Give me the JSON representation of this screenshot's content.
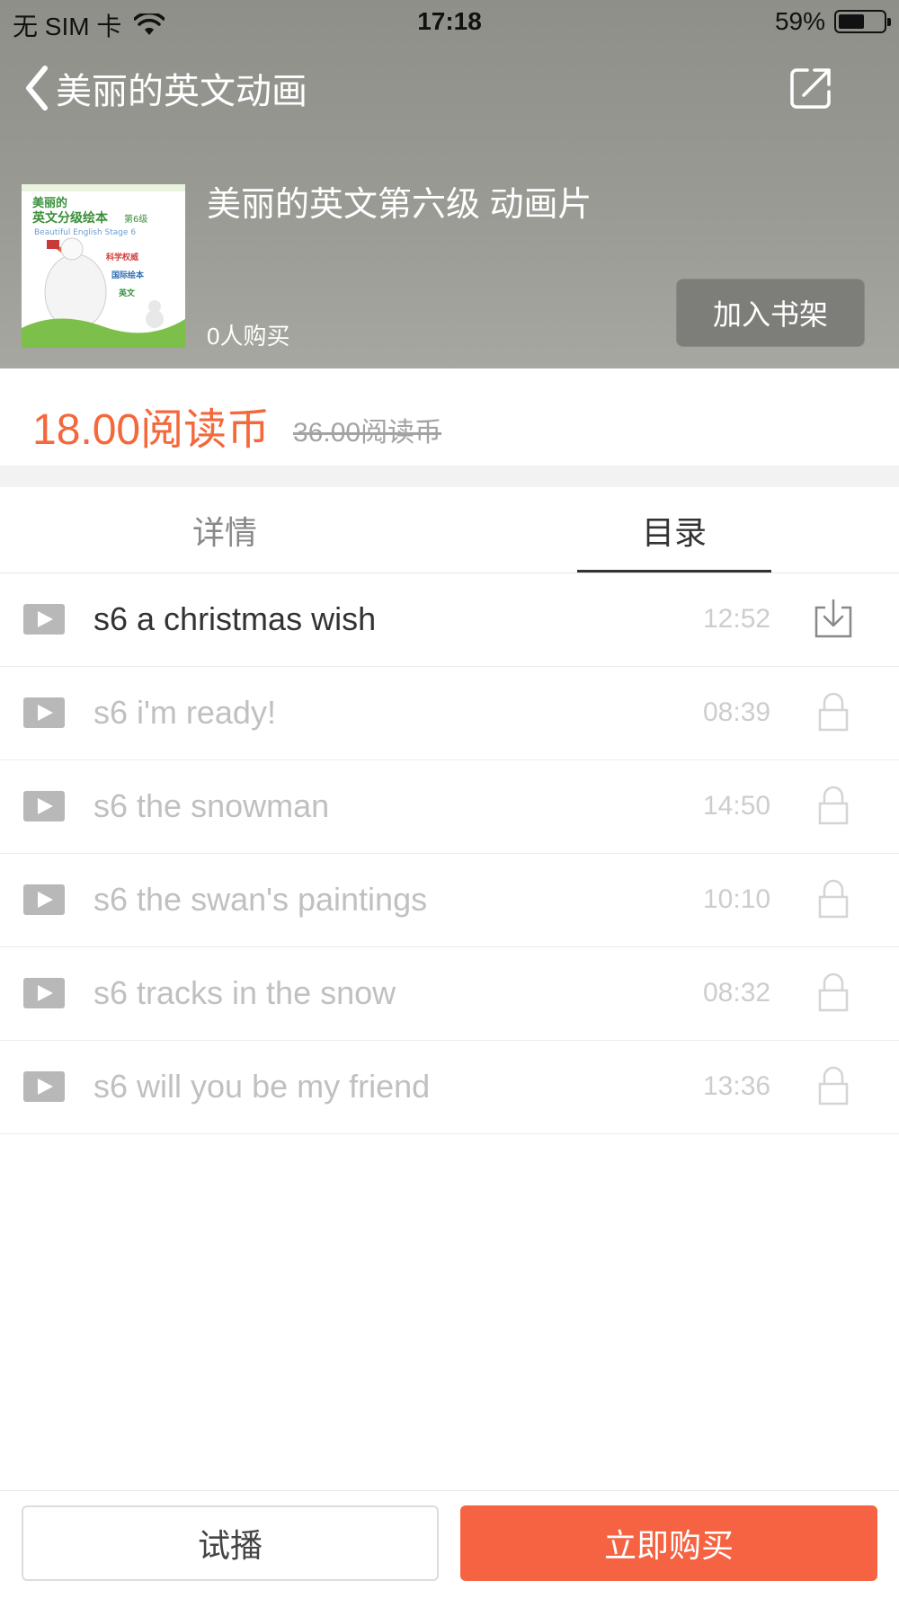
{
  "status_bar": {
    "carrier": "无 SIM 卡",
    "time": "17:18",
    "battery_text": "59%",
    "battery_level": 0.59
  },
  "nav": {
    "title": "美丽的英文动画",
    "back_icon": "chevron-left-icon",
    "share_icon": "share-icon"
  },
  "product": {
    "title": "美丽的英文第六级 动画片",
    "buyers": "0人购买",
    "shelf_button": "加入书架",
    "cover": {
      "series": "美丽的",
      "name": "英文分级绘本",
      "level": "第6级",
      "english": "Beautiful English Stage 6",
      "line1": "科学权威",
      "line2": "国际绘本",
      "line3": "英文"
    }
  },
  "price": {
    "current": "18.00阅读币",
    "original": "36.00阅读币"
  },
  "tabs": [
    {
      "label": "详情",
      "selected": false
    },
    {
      "label": "目录",
      "selected": true
    }
  ],
  "episodes": [
    {
      "title": "s6 a christmas wish",
      "duration": "12:52",
      "state": "download"
    },
    {
      "title": "s6 i'm ready!",
      "duration": "08:39",
      "state": "locked"
    },
    {
      "title": "s6 the snowman",
      "duration": "14:50",
      "state": "locked"
    },
    {
      "title": "s6 the swan's paintings",
      "duration": "10:10",
      "state": "locked"
    },
    {
      "title": "s6 tracks in the snow",
      "duration": "08:32",
      "state": "locked"
    },
    {
      "title": "s6 will you be my friend",
      "duration": "13:36",
      "state": "locked"
    }
  ],
  "bottom": {
    "trial_label": "试播",
    "buy_label": "立即购买"
  },
  "colors": {
    "accent": "#f66343",
    "price": "#f4683b",
    "header_bg": "#9a9a94"
  }
}
